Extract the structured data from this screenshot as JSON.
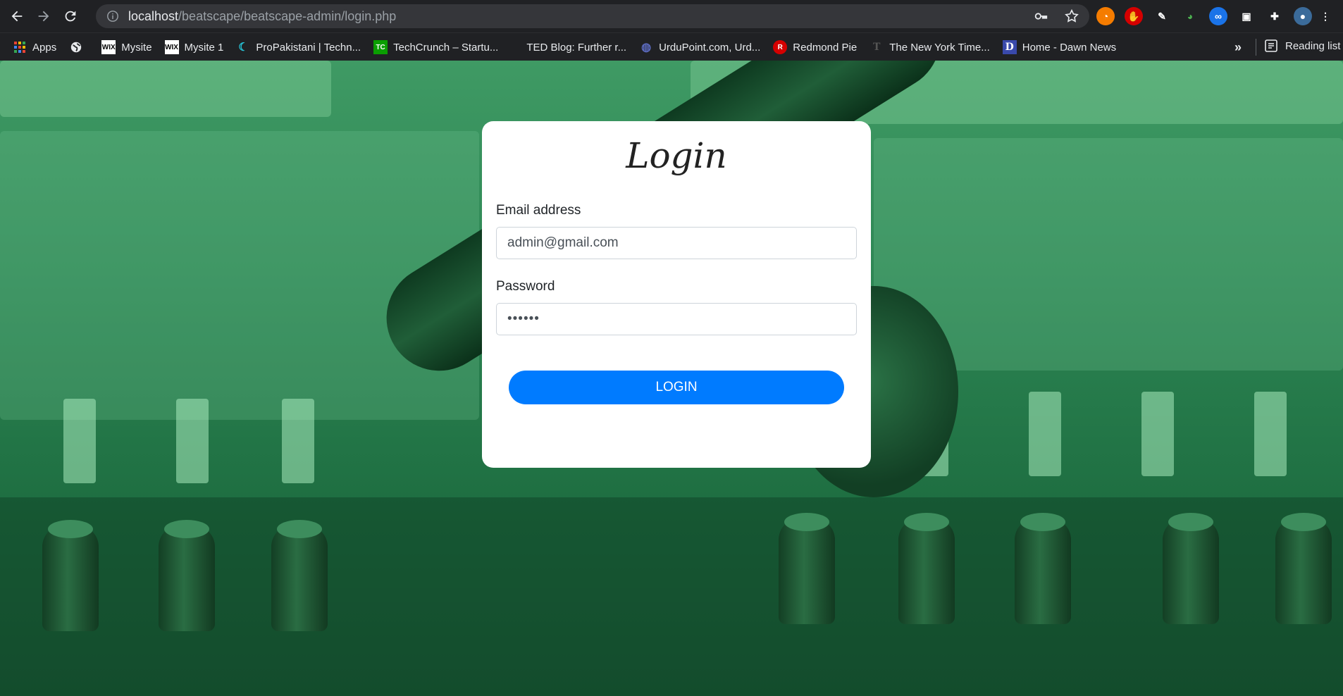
{
  "browser": {
    "url_host": "localhost",
    "url_path": "/beatscape/beatscape-admin/login.php",
    "bookmarks": [
      {
        "label": "Apps",
        "icon": "apps-grid-icon"
      },
      {
        "label": "",
        "icon": "globe-icon"
      },
      {
        "label": "Mysite",
        "icon": "wix-icon"
      },
      {
        "label": "Mysite 1",
        "icon": "wix-icon"
      },
      {
        "label": "ProPakistani | Techn...",
        "icon": "propakistani-icon"
      },
      {
        "label": "TechCrunch – Startu...",
        "icon": "techcrunch-icon"
      },
      {
        "label": "TED Blog: Further r...",
        "icon": "ted-icon"
      },
      {
        "label": "UrduPoint.com, Urd...",
        "icon": "urdupoint-icon"
      },
      {
        "label": "Redmond Pie",
        "icon": "redmondpie-icon"
      },
      {
        "label": "The New York Time...",
        "icon": "nyt-icon"
      },
      {
        "label": "Home - Dawn News",
        "icon": "dawn-icon"
      }
    ],
    "more_label": "»",
    "reading_list_label": "Reading list"
  },
  "login": {
    "title": "Login",
    "email_label": "Email address",
    "email_value": "admin@gmail.com",
    "password_label": "Password",
    "password_value": "••••••",
    "button_label": "LOGIN"
  },
  "colors": {
    "button": "#007bff",
    "overlay": "#2d8654"
  }
}
